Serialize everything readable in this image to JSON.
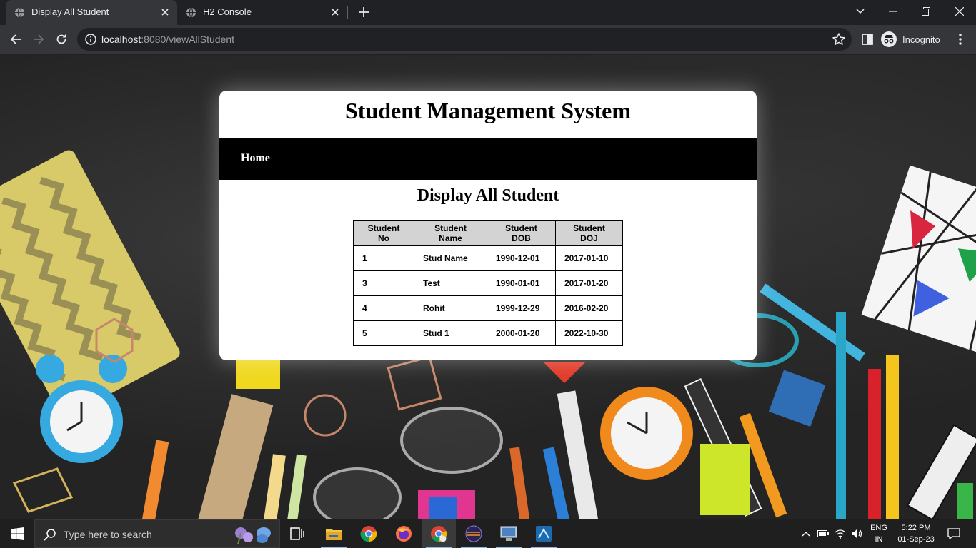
{
  "browser": {
    "tabs": [
      {
        "title": "Display All Student",
        "active": true
      },
      {
        "title": "H2 Console",
        "active": false
      }
    ],
    "url_host": "localhost",
    "url_path": ":8080/viewAllStudent",
    "profile_label": "Incognito"
  },
  "page": {
    "site_title": "Student Management System",
    "nav": {
      "home": "Home"
    },
    "section_title": "Display All Student",
    "table": {
      "headers": [
        "Student No",
        "Student Name",
        "Student DOB",
        "Student DOJ"
      ],
      "rows": [
        [
          "1",
          "Stud Name",
          "1990-12-01",
          "2017-01-10"
        ],
        [
          "3",
          "Test",
          "1990-01-01",
          "2017-01-20"
        ],
        [
          "4",
          "Rohit",
          "1999-12-29",
          "2016-02-20"
        ],
        [
          "5",
          "Stud 1",
          "2000-01-20",
          "2022-10-30"
        ]
      ]
    }
  },
  "taskbar": {
    "search_placeholder": "Type here to search",
    "language": "ENG",
    "region": "IN",
    "time": "5:22 PM",
    "date": "01-Sep-23",
    "apps": [
      "task-view",
      "file-explorer",
      "chrome",
      "firefox",
      "chrome-incognito",
      "eclipse",
      "remote-desktop",
      "app"
    ]
  },
  "colors": {
    "browser_frame": "#202124",
    "toolbar": "#35363a",
    "navbar": "#000000",
    "table_header_bg": "#d3d3d3",
    "taskbar": "#1f1f1f"
  }
}
